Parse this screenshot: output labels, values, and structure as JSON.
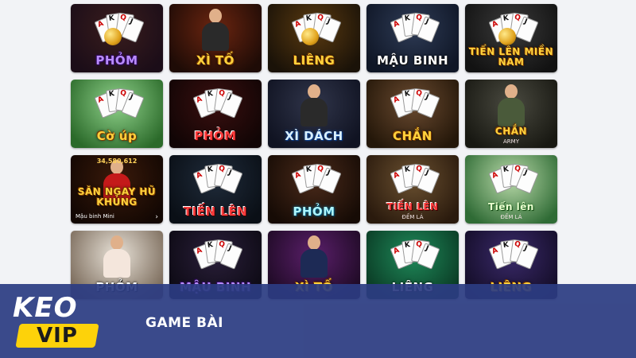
{
  "games": [
    {
      "title": "PHỎM",
      "icon": "coin-cards-icon",
      "style": "purple",
      "bg": "#3a1d1d",
      "bg2": "#1b0d18"
    },
    {
      "title": "XÌ TỐ",
      "icon": "dealer-icon",
      "style": "gold",
      "bg": "#6b2510",
      "bg2": "#1e0b06"
    },
    {
      "title": "LIÊNG",
      "icon": "coin-cards-icon",
      "style": "gold",
      "bg": "#5a3a10",
      "bg2": "#1a1208"
    },
    {
      "title": "MẬU BINH",
      "icon": "dragon-cards-icon",
      "style": "white",
      "bg": "#2e3b55",
      "bg2": "#0f1626"
    },
    {
      "title": "TIẾN LÊN MIỀN NAM",
      "icon": "coin-cards-icon",
      "style": "gold",
      "bg": "#3a3a3a",
      "bg2": "#121212"
    },
    {
      "title": "Cờ úp",
      "icon": "chinese-chess-icon",
      "style": "gold",
      "bg": "#8fd18a",
      "bg2": "#2b6a2a"
    },
    {
      "title": "PHỎM",
      "icon": "cards-fan-icon",
      "style": "red",
      "bg": "#3a0f0f",
      "bg2": "#110505"
    },
    {
      "title": "XÌ DÁCH",
      "icon": "dealer-icon",
      "style": "blue",
      "bg": "#30354a",
      "bg2": "#101322"
    },
    {
      "title": "CHẮN",
      "icon": "cards-fan-icon",
      "style": "gold",
      "bg": "#6a4a30",
      "bg2": "#241709"
    },
    {
      "title": "CHẮN",
      "subtitle": "ARMY",
      "icon": "soldier-icon",
      "style": "gold",
      "bg": "#4a4a40",
      "bg2": "#181812"
    },
    {
      "title": "SĂN NGAY HŨ KHỦNG",
      "jackpot": "34,580,612",
      "label": "Mậu binh Mini",
      "arrow": "›",
      "icon": "god-of-wealth-icon",
      "style": "gold",
      "bg": "#3a1a0a",
      "bg2": "#120703"
    },
    {
      "title": "TIẾN LÊN",
      "icon": "hand-cards-icon",
      "style": "red",
      "bg": "#1f2b3a",
      "bg2": "#0a0f16"
    },
    {
      "title": "PHỎM",
      "icon": "card-table-icon",
      "style": "cyan",
      "bg": "#4a2a1a",
      "bg2": "#160b05"
    },
    {
      "title": "TIẾN LÊN",
      "subtitle": "ĐẾM LÁ",
      "icon": "card-table-icon",
      "style": "red",
      "bg": "#6a5030",
      "bg2": "#2a1a0d"
    },
    {
      "title": "Tiến lên",
      "subtitle": "ĐẾM LÁ",
      "icon": "hand-cards-icon",
      "style": "green",
      "bg": "#b8d9a8",
      "bg2": "#2f6b35"
    },
    {
      "title": "PHỎM",
      "icon": "girl-icon",
      "style": "white",
      "bg": "#e8e2d8",
      "bg2": "#7a6a5a"
    },
    {
      "title": "MẬU BINH",
      "icon": "cards-fan-icon",
      "style": "purple",
      "bg": "#2a1f3a",
      "bg2": "#0d0a14"
    },
    {
      "title": "XÌ TỐ",
      "icon": "pilot-girl-icon",
      "style": "gold",
      "bg": "#5a1f6a",
      "bg2": "#1e0a24"
    },
    {
      "title": "LIÊNG",
      "icon": "hand-cards-icon",
      "style": "white",
      "bg": "#1f8a5a",
      "bg2": "#0a3a24"
    },
    {
      "title": "LIÊNG",
      "icon": "cards-fan-icon",
      "style": "gold",
      "bg": "#3a2a6a",
      "bg2": "#140d28"
    }
  ],
  "banner": {
    "logo_top": "KEO",
    "logo_bottom": "VIP",
    "section_title": "GAME BÀI"
  }
}
